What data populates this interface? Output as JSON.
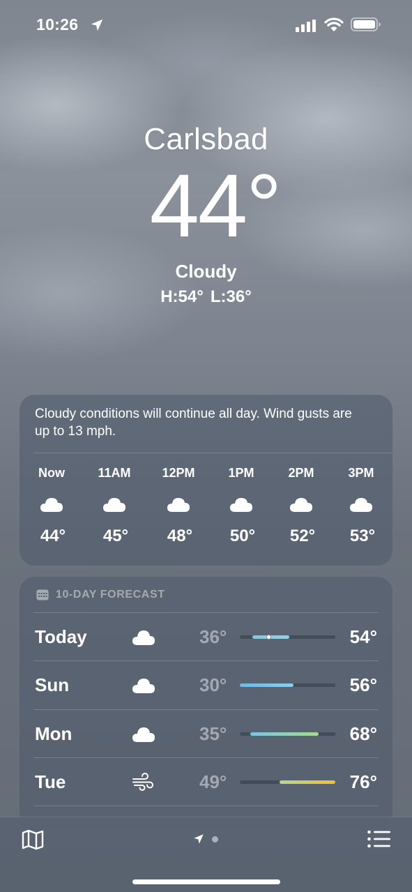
{
  "status_bar": {
    "time": "10:26",
    "icons": [
      "location-arrow-icon",
      "cellular-signal-icon",
      "wifi-icon",
      "battery-icon"
    ]
  },
  "header": {
    "city": "Carlsbad",
    "temperature": "44°",
    "condition": "Cloudy",
    "high": "H:54°",
    "low": "L:36°"
  },
  "hourly": {
    "summary": "Cloudy conditions will continue all day. Wind gusts are up to 13 mph.",
    "hours": [
      {
        "time": "Now",
        "icon": "cloud-icon",
        "temp": "44°"
      },
      {
        "time": "11AM",
        "icon": "cloud-icon",
        "temp": "45°"
      },
      {
        "time": "12PM",
        "icon": "cloud-icon",
        "temp": "48°"
      },
      {
        "time": "1PM",
        "icon": "cloud-icon",
        "temp": "50°"
      },
      {
        "time": "2PM",
        "icon": "cloud-icon",
        "temp": "52°"
      },
      {
        "time": "3PM",
        "icon": "cloud-icon",
        "temp": "53°"
      }
    ]
  },
  "forecast": {
    "title": "10-DAY FORECAST",
    "icon": "calendar-icon",
    "range_min": 30,
    "range_max": 76,
    "days": [
      {
        "day": "Today",
        "icon": "cloud-icon",
        "low": "36°",
        "high": "54°",
        "low_value": 36,
        "high_value": 54,
        "current_value": 44,
        "colors": [
          "#7ec8e3",
          "#8fd3e8"
        ]
      },
      {
        "day": "Sun",
        "icon": "cloud-icon",
        "low": "30°",
        "high": "56°",
        "low_value": 30,
        "high_value": 56,
        "colors": [
          "#6fb8e6",
          "#8ccfe6"
        ]
      },
      {
        "day": "Mon",
        "icon": "cloud-icon",
        "low": "35°",
        "high": "68°",
        "low_value": 35,
        "high_value": 68,
        "colors": [
          "#78c6e4",
          "#a8d890"
        ]
      },
      {
        "day": "Tue",
        "icon": "wind-icon",
        "low": "49°",
        "high": "76°",
        "low_value": 49,
        "high_value": 76,
        "colors": [
          "#b4d886",
          "#f2c12e"
        ]
      }
    ]
  },
  "toolbar": {
    "map_icon": "map-icon",
    "location_icon": "location-arrow-icon",
    "list_icon": "list-icon"
  }
}
